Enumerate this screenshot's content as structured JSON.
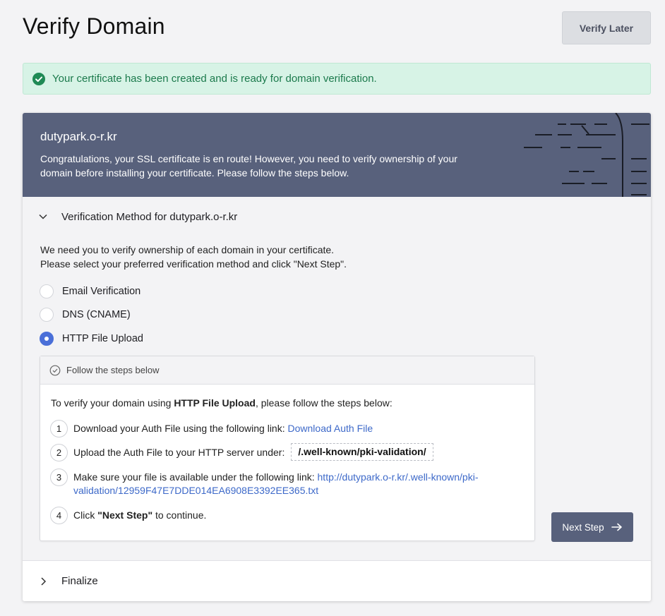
{
  "header": {
    "title": "Verify Domain",
    "verify_later_label": "Verify Later"
  },
  "alert": {
    "message": "Your certificate has been created and is ready for domain verification.",
    "color": "#1b7a4c"
  },
  "banner": {
    "domain": "dutypark.o-r.kr",
    "message": "Congratulations, your SSL certificate is en route! However, you need to verify ownership of your domain before installing your certificate. Please follow the steps below.",
    "background": "#58617c"
  },
  "verification": {
    "section_title": "Verification Method for dutypark.o-r.kr",
    "intro_line1": "We need you to verify ownership of each domain in your certificate.",
    "intro_line2": "Please select your preferred verification method and click \"Next Step\".",
    "options": [
      {
        "label": "Email Verification",
        "selected": false
      },
      {
        "label": "DNS (CNAME)",
        "selected": false
      },
      {
        "label": "HTTP File Upload",
        "selected": true
      }
    ],
    "steps_header": "Follow the steps below",
    "steps_intro_prefix": "To verify your domain using ",
    "steps_intro_method": "HTTP File Upload",
    "steps_intro_suffix": ", please follow the steps below:",
    "steps": [
      {
        "num": "1",
        "text": "Download your Auth File using the following link: ",
        "link": "Download Auth File"
      },
      {
        "num": "2",
        "text": "Upload the Auth File to your HTTP server under:",
        "path": "/.well-known/pki-validation/"
      },
      {
        "num": "3",
        "text": "Make sure your file is available under the following link: ",
        "link_line1": "http://dutypark.o-r.kr/.well-known/pki-",
        "link_line2": "validation/12959F47E7DDE014EA6908E3392EE365.txt"
      },
      {
        "num": "4",
        "text_prefix": "Click ",
        "text_bold": "\"Next Step\"",
        "text_suffix": " to continue."
      }
    ],
    "next_step_label": "Next Step",
    "accent_color": "#4a6fd8"
  },
  "finalize": {
    "section_title": "Finalize"
  }
}
